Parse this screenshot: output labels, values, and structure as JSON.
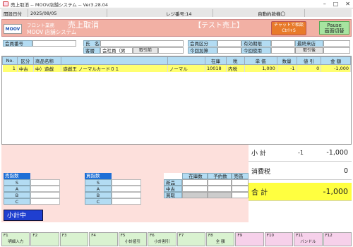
{
  "window": {
    "title": "売上取消 -- MOOV店舗システム -- Ver3.28.04"
  },
  "status": {
    "date_label": "開設日付",
    "date": "2025/08/05",
    "register": "レジ番号:14",
    "auto_msg": "自動約款機〇"
  },
  "header": {
    "logo": "MOOV",
    "dept": "フロント業務",
    "title": "売上取消",
    "system": "MOOV 店舗システム",
    "test_label": "【テスト売上】",
    "chat_btn": "チャットで相談",
    "chat_shortcut": "Ctrl+S",
    "pause_btn": "Pause",
    "pause_sub": "画面切替"
  },
  "customer": {
    "member_no_label": "会員番号",
    "name_label": "氏　名",
    "cust_label": "客層",
    "cust_value": "会社員（男",
    "ref_btn": "取引前",
    "member_class_label": "会員区分",
    "expiry_label": "有効期限",
    "last_visit_label": "最終来店",
    "add_label": "今回加算",
    "use_label": "今回使用",
    "after_btn": "取引後"
  },
  "table": {
    "headers": [
      "No.",
      "区分",
      "商品名称",
      "",
      "",
      "在庫",
      "税",
      "単 価",
      "数量",
      "値 引",
      "金 額"
    ],
    "rows": [
      [
        "1",
        "中古",
        "中）遊戯",
        "遊戯王 ノーマルカード０１",
        "ノーマル",
        "10018",
        "内税",
        "1,000",
        "-1",
        "0",
        "-1,000"
      ]
    ]
  },
  "index_sales": {
    "title": "売指数",
    "rows": [
      "S",
      "A",
      "B",
      "C"
    ]
  },
  "index_buy": {
    "title": "買指数",
    "rows": [
      "S",
      "A",
      "B",
      "C"
    ]
  },
  "stock": {
    "headers": [
      "在庫数",
      "予約数",
      "売価"
    ],
    "rows": [
      "新品",
      "中古",
      "買取"
    ]
  },
  "subtotal_box": "小計中",
  "totals": {
    "subtotal_label": "小 計",
    "subtotal_qty": "-1",
    "subtotal_value": "-1,000",
    "tax_label": "消費税",
    "tax_value": "0",
    "total_label": "合 計",
    "total_value": "-1,000"
  },
  "fkeys": [
    {
      "key": "F1",
      "label": "明細入力"
    },
    {
      "key": "F2",
      "label": ""
    },
    {
      "key": "F3",
      "label": ""
    },
    {
      "key": "F4",
      "label": ""
    },
    {
      "key": "F5",
      "label": "小計値引"
    },
    {
      "key": "F6",
      "label": "小計割引"
    },
    {
      "key": "F7",
      "label": ""
    },
    {
      "key": "F8",
      "label": "全 額"
    },
    {
      "key": "F9",
      "label": ""
    },
    {
      "key": "F10",
      "label": ""
    },
    {
      "key": "F11",
      "label": "バンドル"
    },
    {
      "key": "F12",
      "label": ""
    }
  ],
  "colors": {
    "accent": "#f2b0a4",
    "highlight": "#ffff70",
    "label_bg": "#b3dcf3",
    "fkey_green": "#d9f2d0",
    "fkey_pink": "#f6d0ea"
  }
}
